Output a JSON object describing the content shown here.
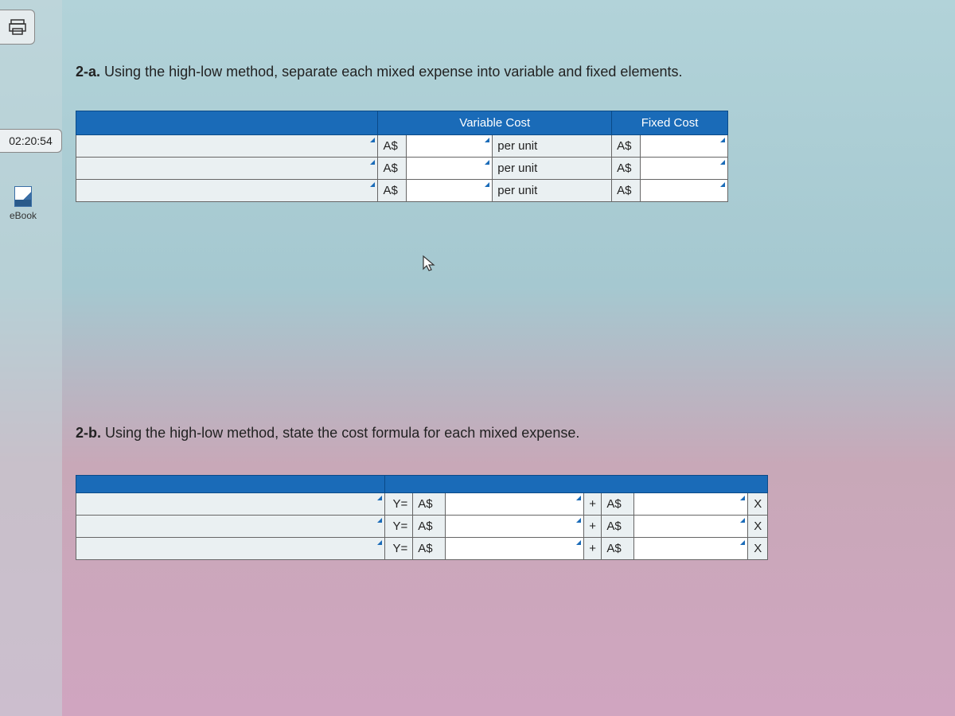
{
  "sidebar": {
    "timer": "02:20:54",
    "ebook_label": "eBook"
  },
  "section_a": {
    "prefix": "2-a.",
    "text": "Using the high-low method, separate each mixed expense into variable and fixed elements.",
    "headers": {
      "variable": "Variable Cost",
      "fixed": "Fixed Cost"
    },
    "rows": [
      {
        "currency1": "A$",
        "unit": "per unit",
        "currency2": "A$"
      },
      {
        "currency1": "A$",
        "unit": "per unit",
        "currency2": "A$"
      },
      {
        "currency1": "A$",
        "unit": "per unit",
        "currency2": "A$"
      }
    ]
  },
  "section_b": {
    "prefix": "2-b.",
    "text": "Using the high-low method, state the cost formula for each mixed expense.",
    "rows": [
      {
        "y": "Y=",
        "c1": "A$",
        "plus": "+",
        "c2": "A$",
        "x": "X"
      },
      {
        "y": "Y=",
        "c1": "A$",
        "plus": "+",
        "c2": "A$",
        "x": "X"
      },
      {
        "y": "Y=",
        "c1": "A$",
        "plus": "+",
        "c2": "A$",
        "x": "X"
      }
    ]
  }
}
